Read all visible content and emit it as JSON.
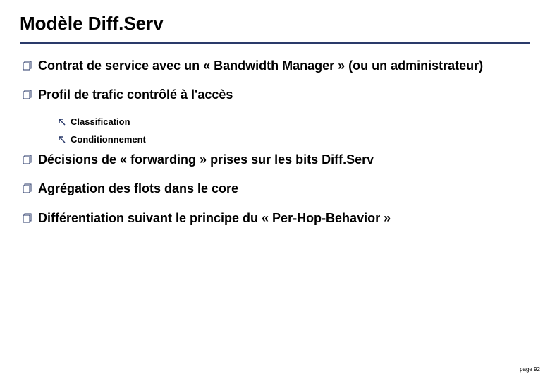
{
  "title": "Modèle Diff.Serv",
  "bullets": [
    {
      "text": "Contrat de service avec un « Bandwidth Manager » (ou un administrateur)"
    },
    {
      "text": "Profil de trafic contrôlé à l'accès",
      "sub": [
        {
          "text": "Classification"
        },
        {
          "text": "Conditionnement"
        }
      ]
    },
    {
      "text": "Décisions de « forwarding » prises sur les bits Diff.Serv"
    },
    {
      "text": "Agrégation des flots dans le core"
    },
    {
      "text": "Différentiation suivant le principe du « Per-Hop-Behavior »"
    }
  ],
  "footer": "page 92"
}
